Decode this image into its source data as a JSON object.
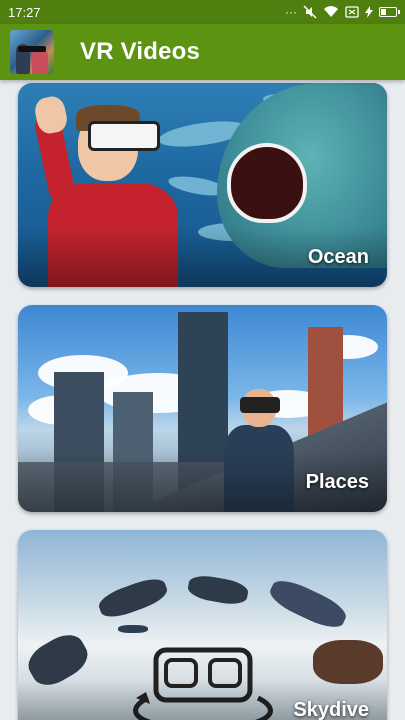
{
  "status_bar": {
    "time": "17:27",
    "icons": [
      "more-icon",
      "mute-icon",
      "wifi-icon",
      "sim-icon",
      "charging-icon",
      "battery-icon"
    ],
    "battery_level": 0.35
  },
  "app_bar": {
    "title": "VR Videos",
    "logo_icon": "app-logo-icon"
  },
  "categories": [
    {
      "label": "Ocean"
    },
    {
      "label": "Places"
    },
    {
      "label": "Skydive"
    }
  ],
  "colors": {
    "status_bar_bg": "#4f7f0f",
    "app_bar_bg": "#5c9412",
    "page_bg": "#e9ecef"
  }
}
